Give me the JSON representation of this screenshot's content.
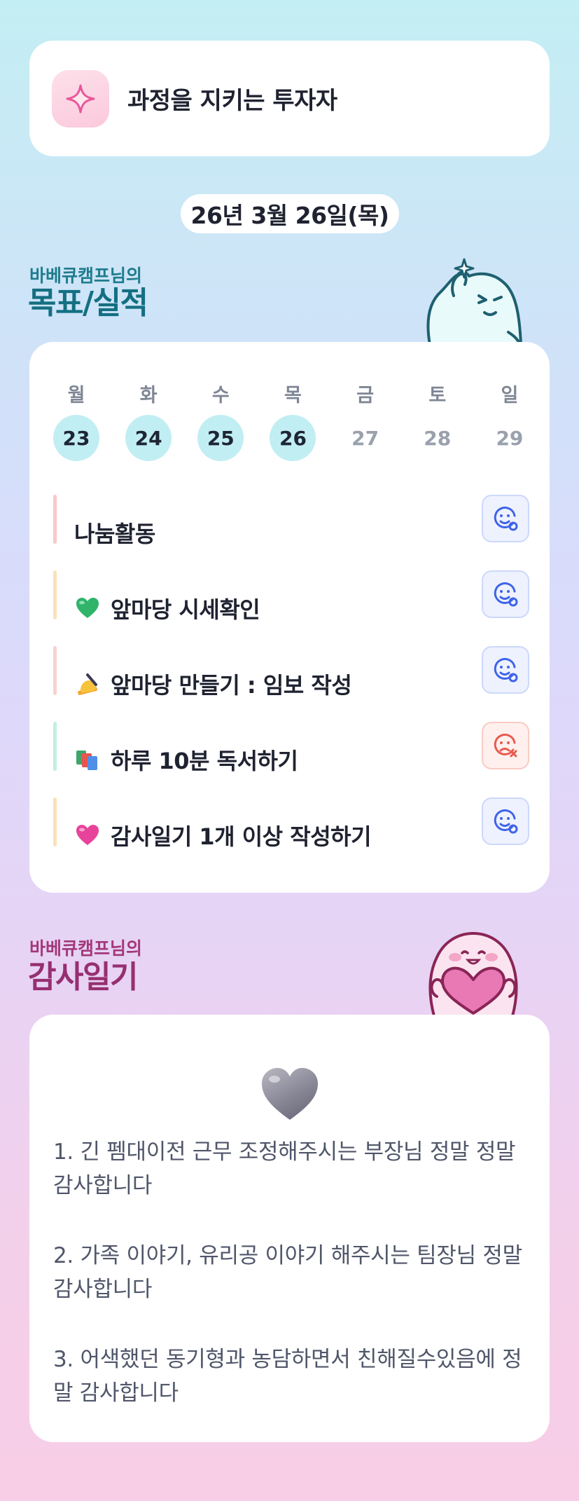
{
  "header": {
    "title": "과정을 지키는 투자자",
    "icon": "sparkle-icon"
  },
  "date": "26년 3월 26일(목)",
  "goals_section": {
    "subtitle": "바베큐캠프님의",
    "title": "목표/실적",
    "week": [
      {
        "day": "월",
        "date": "23",
        "active": true
      },
      {
        "day": "화",
        "date": "24",
        "active": true
      },
      {
        "day": "수",
        "date": "25",
        "active": true
      },
      {
        "day": "목",
        "date": "26",
        "active": true
      },
      {
        "day": "금",
        "date": "27",
        "active": false
      },
      {
        "day": "토",
        "date": "28",
        "active": false
      },
      {
        "day": "일",
        "date": "29",
        "active": false
      }
    ],
    "goals": [
      {
        "label": "나눔활동",
        "emoji": "",
        "bar_color": "#f9c9c7",
        "status": "done"
      },
      {
        "label": "앞마당 시세확인",
        "emoji": "green-heart-icon",
        "bar_color": "#fbe1b8",
        "status": "done"
      },
      {
        "label": "앞마당 만들기 : 임보 작성",
        "emoji": "writing-hand-icon",
        "bar_color": "#f9d2d0",
        "status": "done"
      },
      {
        "label": "하루 10분 독서하기",
        "emoji": "books-icon",
        "bar_color": "#c2f0dc",
        "status": "failed"
      },
      {
        "label": "감사일기 1개 이상 작성하기",
        "emoji": "pink-heart-icon",
        "bar_color": "#fbe1b8",
        "status": "done"
      }
    ]
  },
  "thanks_section": {
    "subtitle": "바베큐캠프님의",
    "title": "감사일기",
    "items": [
      "1. 긴 펨대이전 근무 조정해주시는 부장님 정말 정말 감사합니다",
      "2. 가족 이야기, 유리공 이야기 해주시는 팀장님 정말 감사합니다",
      "3. 어색했던 동기형과 농담하면서 친해질수있음에 정말 감사합니다"
    ]
  },
  "colors": {
    "active_day": "#c1eef3",
    "goal_title": "#146f82",
    "thanks_title": "#962f70",
    "status_ok": "#3f63e8",
    "status_fail": "#e85a4f"
  }
}
